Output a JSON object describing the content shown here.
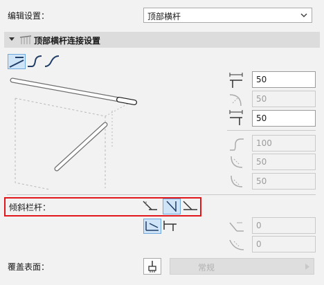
{
  "edit_setting": {
    "label": "编辑设置：",
    "value": "顶部横杆"
  },
  "section": {
    "title": "顶部横杆连接设置"
  },
  "fields": {
    "length_top": "50",
    "radius_top": "50",
    "length_bottom": "50",
    "offset": "100",
    "radius_a": "50",
    "radius_b": "50",
    "slope_a": "0",
    "slope_b": "0"
  },
  "slope_rail": {
    "label": "倾斜栏杆：",
    "selected_index": 1
  },
  "surface": {
    "label": "覆盖表面：",
    "value": "常规"
  },
  "colors": {
    "accent": "#6fa8dc",
    "highlight": "#e0161b",
    "selected_bg": "#cfe4f7"
  }
}
